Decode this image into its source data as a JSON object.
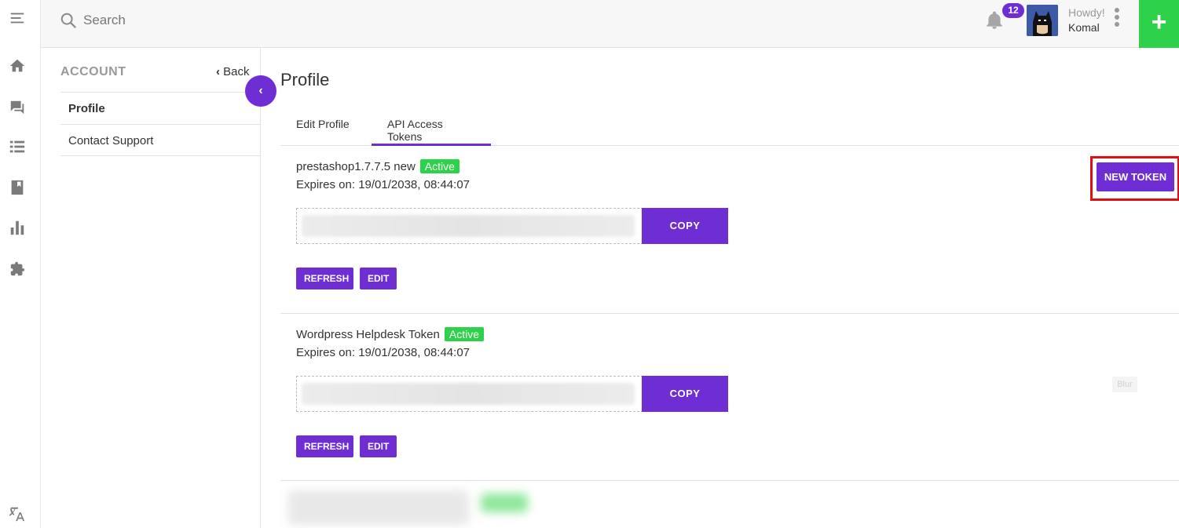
{
  "search": {
    "placeholder": "Search"
  },
  "header": {
    "notification_count": "12",
    "greeting": "Howdy!",
    "user_name": "Komal",
    "add_label": "+"
  },
  "account": {
    "title": "ACCOUNT",
    "back_label": "Back",
    "menu": [
      {
        "label": "Profile"
      },
      {
        "label": "Contact Support"
      }
    ]
  },
  "main": {
    "title": "Profile",
    "tabs": [
      {
        "label": "Edit Profile"
      },
      {
        "label": "API Access Tokens"
      }
    ],
    "new_token_label": "NEW TOKEN",
    "blur_note": "Blur"
  },
  "tokens": [
    {
      "name": "prestashop1.7.7.5 new",
      "status": "Active",
      "expires": "Expires on: 19/01/2038, 08:44:07",
      "copy_label": "COPY",
      "refresh_label": "REFRESH",
      "edit_label": "EDIT"
    },
    {
      "name": "Wordpress Helpdesk Token",
      "status": "Active",
      "expires": "Expires on: 19/01/2038, 08:44:07",
      "copy_label": "COPY",
      "refresh_label": "REFRESH",
      "edit_label": "EDIT"
    }
  ],
  "colors": {
    "accent": "#6f2dd4",
    "success": "#2ed24a",
    "highlight": "#e01010"
  },
  "icons": [
    "menu-icon",
    "home-icon",
    "chat-icon",
    "list-icon",
    "book-icon",
    "chart-icon",
    "puzzle-icon",
    "translate-icon",
    "search-icon",
    "bell-icon"
  ]
}
